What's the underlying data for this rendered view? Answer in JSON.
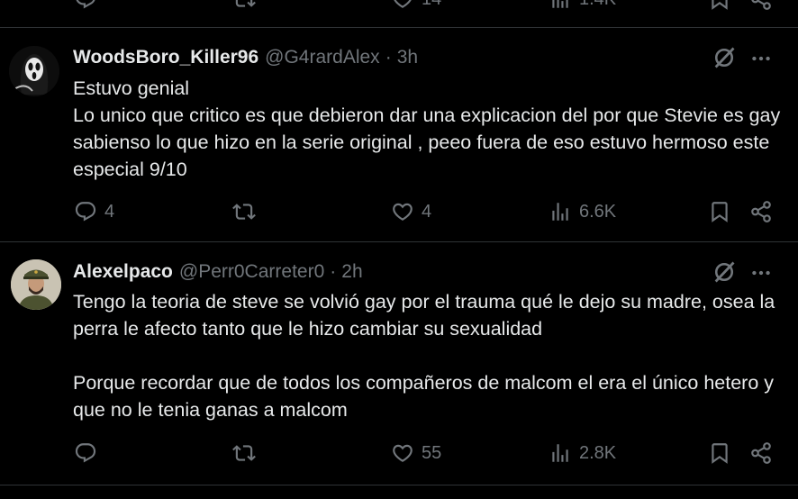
{
  "colors": {
    "background": "#000000",
    "text": "#e7e9ea",
    "muted": "#71767b",
    "divider": "#2f3336"
  },
  "top_partial": {
    "like_count": "14",
    "views_count": "1.4K"
  },
  "posts": [
    {
      "display_name": "WoodsBoro_Killer96",
      "handle": "@G4rardAlex",
      "separator": "·",
      "time": "3h",
      "text": "Estuvo genial\nLo unico que critico es que debieron dar una explicacion del por que Stevie es gay sabienso lo que hizo en la serie original , peeo fuera de eso estuvo hermoso este especial 9/10",
      "replies": "4",
      "reposts": "",
      "likes": "4",
      "views": "6.6K",
      "avatar_icon": "ghostface-avatar-icon"
    },
    {
      "display_name": "Alexelpaco",
      "handle": "@Perr0Carreter0",
      "separator": "·",
      "time": "2h",
      "text": "Tengo la teoria de steve se volvió gay por el trauma qué le dejo su madre, osea la perra le afecto tanto que le hizo cambiar su sexualidad\n\nPorque recordar que de todos los compañeros de malcom el era el único hetero y que no le tenia ganas a malcom",
      "replies": "",
      "reposts": "",
      "likes": "55",
      "views": "2.8K",
      "avatar_icon": "soldier-avatar-icon"
    }
  ]
}
